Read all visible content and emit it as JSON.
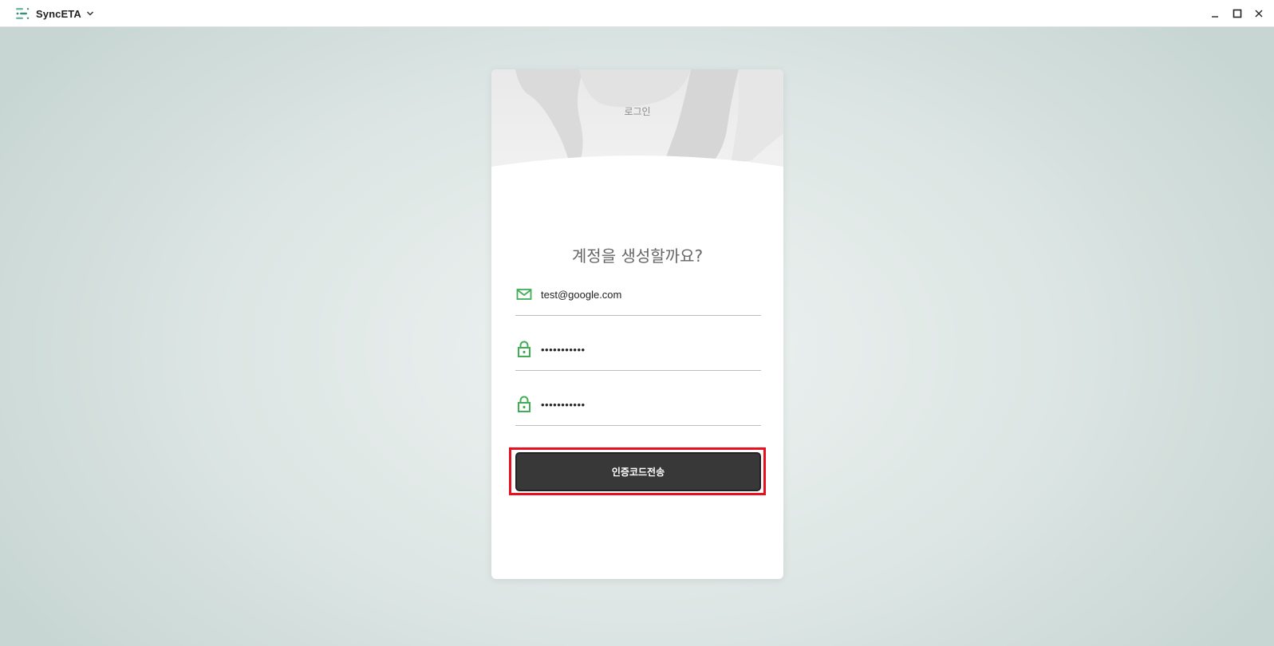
{
  "app": {
    "name": "SyncETA",
    "logo_icon": "syncETA-logo-icon",
    "menu_icon": "chevron-down-icon",
    "window_controls": [
      "minimize-icon",
      "maximize-icon",
      "close-icon"
    ]
  },
  "card": {
    "header_title": "로그인",
    "heading": "계정을 생성할까요?",
    "fields": {
      "email": {
        "value": "test@google.com",
        "icon": "mail-icon"
      },
      "password": {
        "value": "•••••••••••",
        "icon": "lock-icon"
      },
      "password_confirm": {
        "value": "•••••••••••",
        "icon": "lock-icon"
      }
    },
    "submit_label": "인증코드전송"
  },
  "colors": {
    "accent_green": "#3fae55",
    "button_bg": "#383838",
    "highlight_border": "#e8101f"
  }
}
